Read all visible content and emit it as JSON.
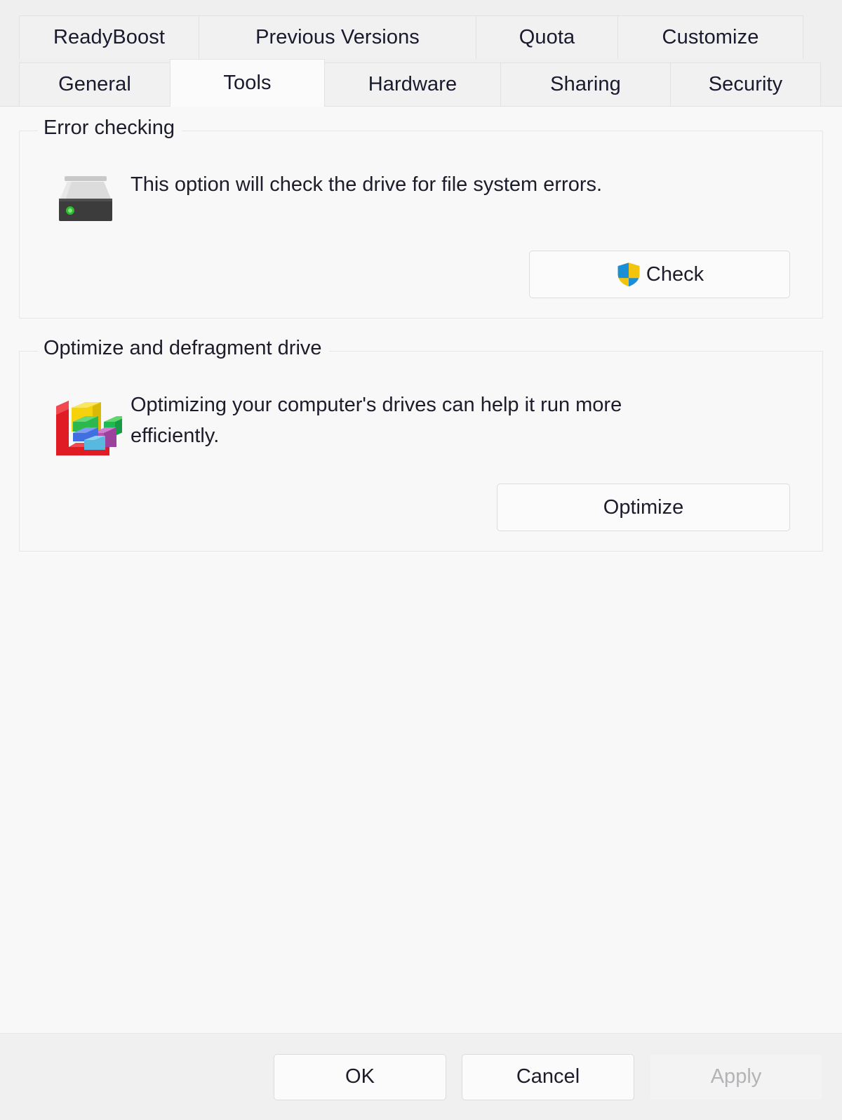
{
  "dialog": {
    "tabs_row1": [
      {
        "label": "ReadyBoost",
        "name": "tab-readyboost",
        "selected": false
      },
      {
        "label": "Previous Versions",
        "name": "tab-previous-versions",
        "selected": false
      },
      {
        "label": "Quota",
        "name": "tab-quota",
        "selected": false
      },
      {
        "label": "Customize",
        "name": "tab-customize",
        "selected": false
      }
    ],
    "tabs_row2": [
      {
        "label": "General",
        "name": "tab-general",
        "selected": false
      },
      {
        "label": "Tools",
        "name": "tab-tools",
        "selected": true
      },
      {
        "label": "Hardware",
        "name": "tab-hardware",
        "selected": false
      },
      {
        "label": "Sharing",
        "name": "tab-sharing",
        "selected": false
      },
      {
        "label": "Security",
        "name": "tab-security",
        "selected": false
      }
    ]
  },
  "error_checking": {
    "legend": "Error checking",
    "description": "This option will check the drive for file system errors.",
    "button_label": "Check",
    "icon": "hard-drive-icon",
    "button_icon": "uac-shield-icon"
  },
  "optimize": {
    "legend": "Optimize and defragment drive",
    "description": "Optimizing your computer's drives can help it run more efficiently.",
    "button_label": "Optimize",
    "icon": "defragment-blocks-icon"
  },
  "footer": {
    "ok_label": "OK",
    "cancel_label": "Cancel",
    "apply_label": "Apply",
    "apply_disabled": true
  },
  "colors": {
    "dialog_bg": "#efefef",
    "content_bg": "#f8f8f8",
    "tab_bg": "#f1f1f1",
    "tab_selected_bg": "#fbfbfb",
    "border": "#e2e2e2",
    "text": "#1c1c2b",
    "disabled_text": "#b4b4b8",
    "shield_blue": "#1a8fd8",
    "shield_yellow": "#f2c40d",
    "drive_body": "#3c3c3c",
    "drive_top": "#dcdcdc",
    "drive_led": "#2fbd2f"
  }
}
